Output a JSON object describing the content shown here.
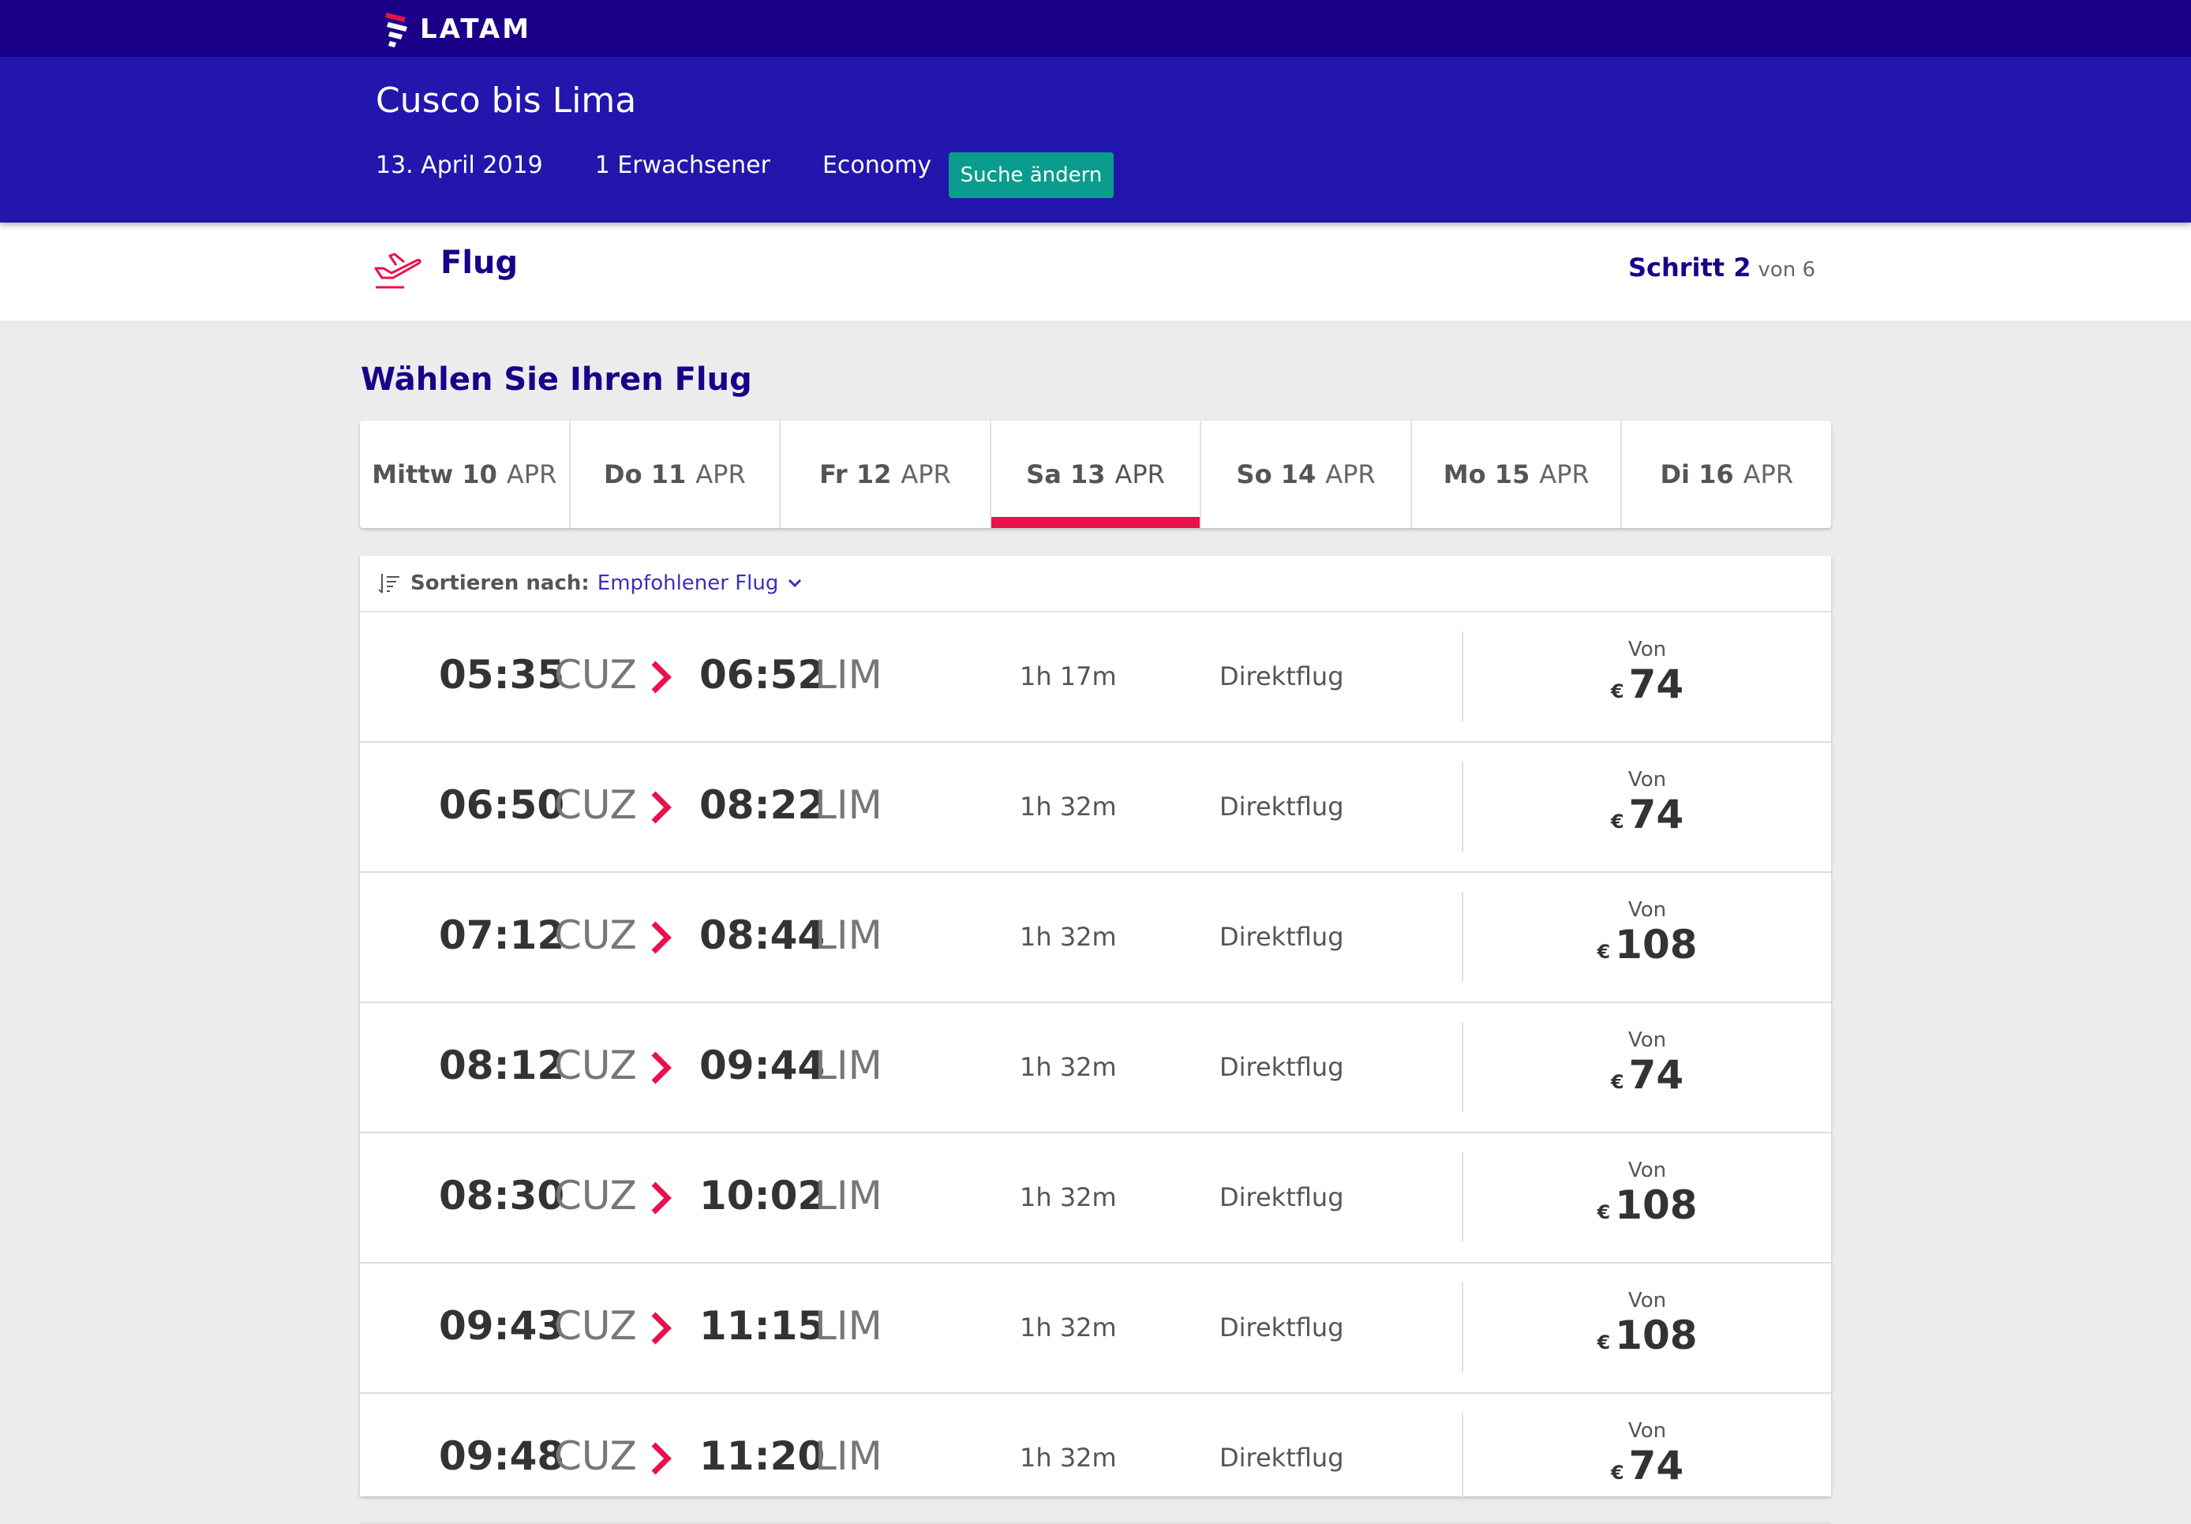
{
  "brand": {
    "name": "LATAM"
  },
  "search": {
    "route": "Cusco bis Lima",
    "date": "13. April 2019",
    "passengers": "1 Erwachsener",
    "cabin": "Economy",
    "change_label": "Suche ändern"
  },
  "step": {
    "name": "Flug",
    "label": "Schritt 2",
    "of": "von 6"
  },
  "section": {
    "title": "Wählen Sie Ihren Flug"
  },
  "date_tabs": [
    {
      "day": "Mittw 10",
      "month": "APR",
      "active": false
    },
    {
      "day": "Do 11",
      "month": "APR",
      "active": false
    },
    {
      "day": "Fr 12",
      "month": "APR",
      "active": false
    },
    {
      "day": "Sa 13",
      "month": "APR",
      "active": true
    },
    {
      "day": "So 14",
      "month": "APR",
      "active": false
    },
    {
      "day": "Mo 15",
      "month": "APR",
      "active": false
    },
    {
      "day": "Di 16",
      "month": "APR",
      "active": false
    }
  ],
  "sort": {
    "label": "Sortieren nach:",
    "value": "Empfohlener Flug"
  },
  "flights": [
    {
      "dep_time": "05:35",
      "dep_code": "CUZ",
      "arr_time": "06:52",
      "arr_code": "LIM",
      "duration": "1h 17m",
      "stops": "Direktflug",
      "price_from": "Von",
      "currency": "€",
      "price": "74"
    },
    {
      "dep_time": "06:50",
      "dep_code": "CUZ",
      "arr_time": "08:22",
      "arr_code": "LIM",
      "duration": "1h 32m",
      "stops": "Direktflug",
      "price_from": "Von",
      "currency": "€",
      "price": "74"
    },
    {
      "dep_time": "07:12",
      "dep_code": "CUZ",
      "arr_time": "08:44",
      "arr_code": "LIM",
      "duration": "1h 32m",
      "stops": "Direktflug",
      "price_from": "Von",
      "currency": "€",
      "price": "108"
    },
    {
      "dep_time": "08:12",
      "dep_code": "CUZ",
      "arr_time": "09:44",
      "arr_code": "LIM",
      "duration": "1h 32m",
      "stops": "Direktflug",
      "price_from": "Von",
      "currency": "€",
      "price": "74"
    },
    {
      "dep_time": "08:30",
      "dep_code": "CUZ",
      "arr_time": "10:02",
      "arr_code": "LIM",
      "duration": "1h 32m",
      "stops": "Direktflug",
      "price_from": "Von",
      "currency": "€",
      "price": "108"
    },
    {
      "dep_time": "09:43",
      "dep_code": "CUZ",
      "arr_time": "11:15",
      "arr_code": "LIM",
      "duration": "1h 32m",
      "stops": "Direktflug",
      "price_from": "Von",
      "currency": "€",
      "price": "108"
    },
    {
      "dep_time": "09:48",
      "dep_code": "CUZ",
      "arr_time": "11:20",
      "arr_code": "LIM",
      "duration": "1h 32m",
      "stops": "Direktflug",
      "price_from": "Von",
      "currency": "€",
      "price": "74"
    }
  ],
  "colors": {
    "topbar": "#1b0088",
    "header": "#2216ad",
    "accent": "#e8114b",
    "button": "#0a9c8c"
  },
  "icons": {
    "logo": "latam-logo-icon",
    "flight": "plane-takeoff-icon",
    "sort": "sort-icon",
    "chevron": "chevron-down-icon",
    "arrow": "chevron-right-icon"
  }
}
